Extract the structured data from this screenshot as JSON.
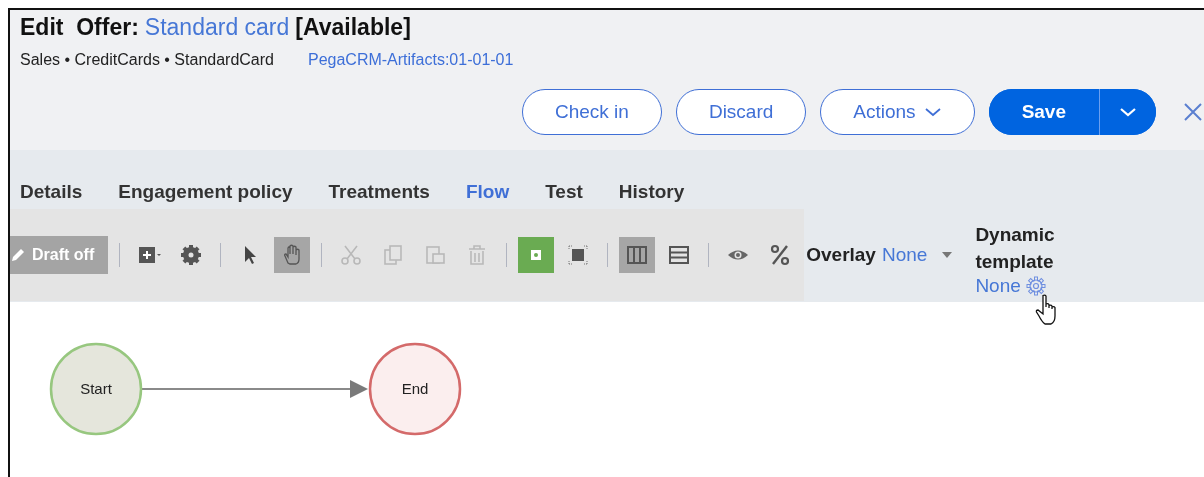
{
  "header": {
    "title_prefix": "Edit  Offer:",
    "title_link": "Standard card",
    "status": "[Available]",
    "breadcrumb": "Sales • CreditCards • StandardCard",
    "ruleset": "PegaCRM-Artifacts:01-01-01"
  },
  "actions": [
    {
      "label": "Check in",
      "kind": "outline"
    },
    {
      "label": "Discard",
      "kind": "outline"
    },
    {
      "label": "Actions",
      "kind": "menu"
    },
    {
      "label": "Save",
      "kind": "primary"
    }
  ],
  "tabs": [
    {
      "label": "Details",
      "selected": false
    },
    {
      "label": "Engagement policy",
      "selected": false
    },
    {
      "label": "Treatments",
      "selected": false
    },
    {
      "label": "Flow",
      "selected": true
    },
    {
      "label": "Test",
      "selected": false
    },
    {
      "label": "History",
      "selected": false
    }
  ],
  "toolbar": {
    "draft": {
      "label": "Draft off",
      "on": false
    },
    "groups": [
      [
        {
          "kind": "add",
          "selected": false,
          "disabled": false
        },
        {
          "kind": "gear",
          "selected": false,
          "disabled": false
        }
      ],
      [
        {
          "kind": "pointer",
          "selected": false,
          "disabled": false
        },
        {
          "kind": "hand",
          "selected": true,
          "disabled": false
        }
      ],
      [
        {
          "kind": "cut",
          "selected": false,
          "disabled": true
        },
        {
          "kind": "copy",
          "selected": false,
          "disabled": true
        },
        {
          "kind": "paste",
          "selected": false,
          "disabled": true
        },
        {
          "kind": "delete",
          "selected": false,
          "disabled": true
        }
      ],
      [
        {
          "kind": "node",
          "selected": true,
          "disabled": false
        },
        {
          "kind": "fit",
          "selected": false,
          "disabled": false
        }
      ],
      [
        {
          "kind": "columns",
          "selected": true,
          "disabled": false
        },
        {
          "kind": "rows",
          "selected": false,
          "disabled": false
        }
      ],
      [
        {
          "kind": "eye",
          "selected": false,
          "disabled": false
        },
        {
          "kind": "percent",
          "selected": false,
          "disabled": false
        }
      ]
    ],
    "overlay": {
      "label": "Overlay",
      "value": "None"
    },
    "template": {
      "label": "Dynamic template",
      "value": "None"
    }
  },
  "flow": {
    "nodes": [
      {
        "label": "Start",
        "kind": "start"
      },
      {
        "label": "End",
        "kind": "end"
      }
    ]
  }
}
